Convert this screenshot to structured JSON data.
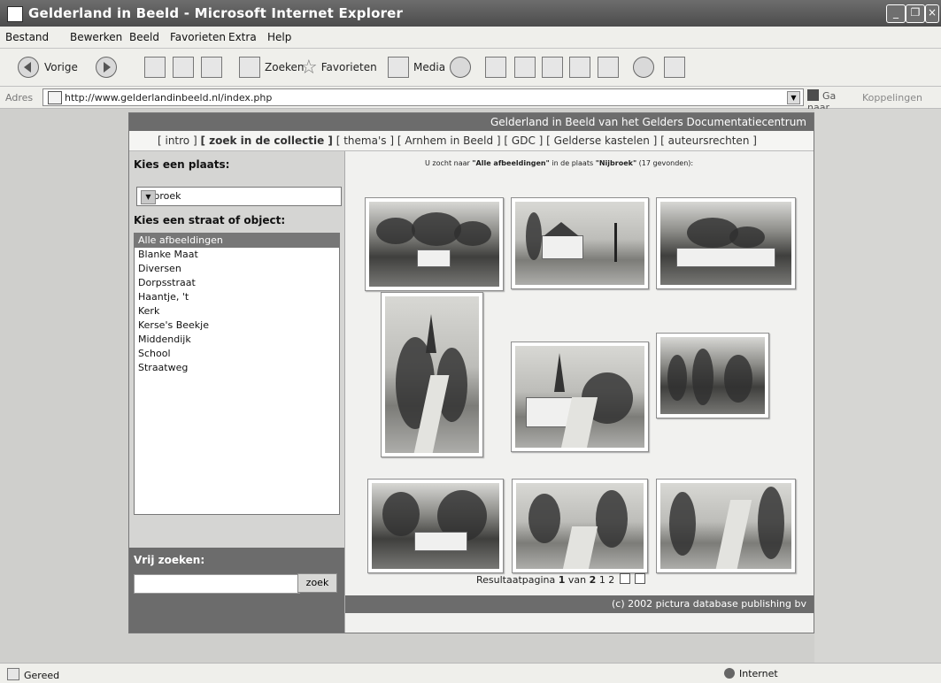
{
  "window": {
    "title": "Gelderland in Beeld - Microsoft Internet Explorer",
    "buttons": [
      "_",
      "❐",
      "×"
    ]
  },
  "menu": [
    "Bestand",
    "Bewerken",
    "Beeld",
    "Favorieten",
    "Extra",
    "Help"
  ],
  "toolbar": {
    "back": "Vorige",
    "search": "Zoeken",
    "favorites": "Favorieten",
    "media": "Media"
  },
  "address": {
    "label": "Adres",
    "url": "http://www.gelderlandinbeeld.nl/index.php",
    "go": "Ga naar",
    "links": "Koppelingen"
  },
  "site": {
    "header": "Gelderland in Beeld van het Gelders Documentatiecentrum",
    "nav": [
      "[ intro ]",
      "[ zoek in de collectie ]",
      "[ thema's ]",
      "[ Arnhem in Beeld ]",
      "[ GDC ]",
      "[ Gelderse kastelen ]",
      "[ auteursrechten ]"
    ],
    "place_title": "Kies een plaats:",
    "selected_place": "Nijbroek",
    "street_title": "Kies een straat of object:",
    "streets": [
      "Alle afbeeldingen",
      "Blanke Maat",
      "Diversen",
      "Dorpsstraat",
      "Haantje, 't",
      "Kerk",
      "Kerse's Beekje",
      "Middendijk",
      "School",
      "Straatweg"
    ],
    "search_title": "Vrij zoeken:",
    "search_value": "",
    "search_button": "zoek",
    "result_prefix": "U zocht naar",
    "result_query": "\"Alle afbeeldingen\"",
    "result_middle": "in de plaats",
    "result_place": "\"Nijbroek\"",
    "result_count": "(17 gevonden):",
    "pager_label": "Resultaatpagina",
    "pager_current": "1",
    "pager_of": "van",
    "pager_total": "2",
    "pager_links": "1 2",
    "copyright": "(c) 2002 pictura database publishing bv"
  },
  "status": {
    "left": "Gereed",
    "right": "Internet"
  }
}
